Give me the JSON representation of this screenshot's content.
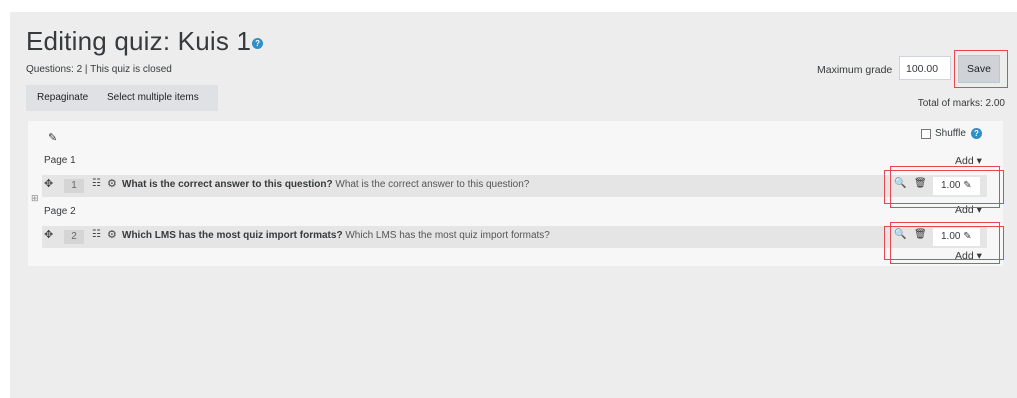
{
  "header": {
    "title": "Editing quiz: Kuis 1",
    "help_icon": "question-circle-icon",
    "status": "Questions: 2 | This quiz is closed"
  },
  "grade": {
    "max_grade_label": "Maximum grade",
    "max_grade_value": "100.00",
    "save_label": "Save",
    "total_marks": "Total of marks: 2.00"
  },
  "toolbar": {
    "repaginate_label": "Repaginate",
    "select_multiple_label": "Select multiple items"
  },
  "section": {
    "shuffle_label": "Shuffle",
    "edit_heading_icon": "pencil-icon"
  },
  "pages": [
    {
      "label": "Page 1",
      "add_label": "Add ▾",
      "question": {
        "number": "1",
        "title": "What is the correct answer to this question?",
        "text": "What is the correct answer to this question?",
        "mark": "1.00"
      }
    },
    {
      "label": "Page 2",
      "add_label": "Add ▾",
      "question": {
        "number": "2",
        "title": "Which LMS has the most quiz import formats?",
        "text": "Which LMS has the most quiz import formats?",
        "mark": "1.00"
      }
    }
  ],
  "last_add_label": "Add ▾",
  "colors": {
    "background": "#ededed",
    "content": "#f7f7f7",
    "question_row": "#e5e5e5",
    "highlight": "#e8484b",
    "help": "#2f8fc6"
  }
}
